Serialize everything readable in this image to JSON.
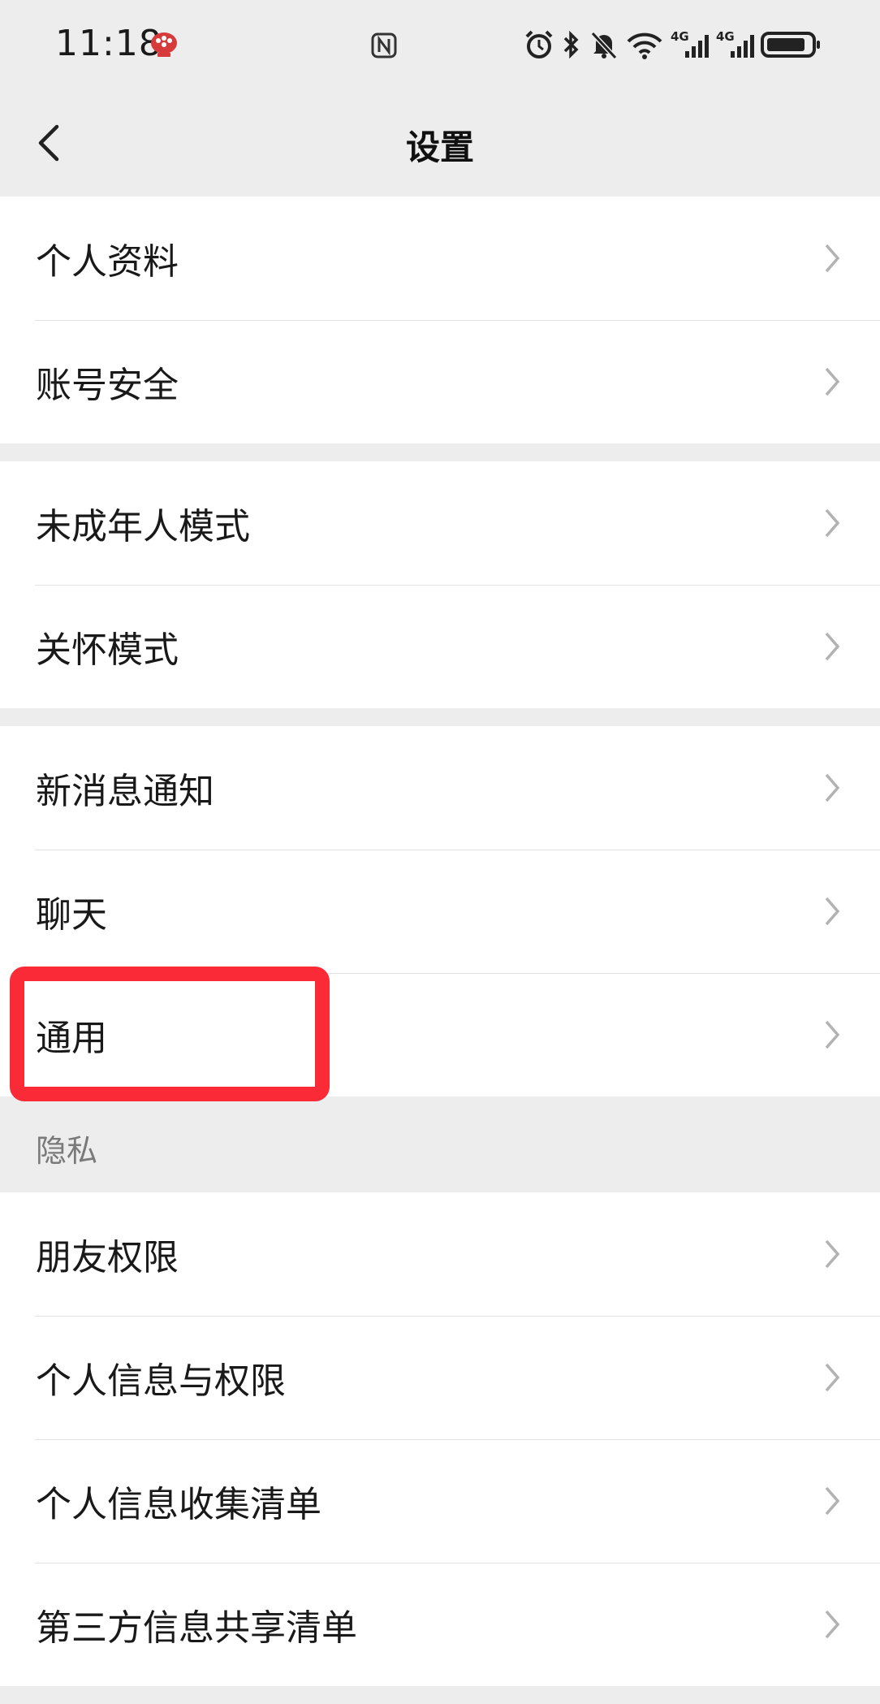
{
  "status_bar": {
    "time": "11:18",
    "icons": [
      "app-notification-icon",
      "nfc-icon",
      "alarm-icon",
      "bluetooth-icon",
      "mute-icon",
      "wifi-icon",
      "signal-4g-icon",
      "signal-4g-icon",
      "battery-icon"
    ],
    "signal_label_1": "4G",
    "signal_label_2": "4G"
  },
  "nav": {
    "title": "设置",
    "back_icon": "back-arrow-icon"
  },
  "groups": [
    {
      "items": [
        {
          "label": "个人资料"
        },
        {
          "label": "账号安全"
        }
      ]
    },
    {
      "items": [
        {
          "label": "未成年人模式"
        },
        {
          "label": "关怀模式"
        }
      ]
    },
    {
      "items": [
        {
          "label": "新消息通知"
        },
        {
          "label": "聊天"
        },
        {
          "label": "通用"
        }
      ]
    },
    {
      "header": "隐私",
      "items": [
        {
          "label": "朋友权限"
        },
        {
          "label": "个人信息与权限"
        },
        {
          "label": "个人信息收集清单"
        },
        {
          "label": "第三方信息共享清单"
        }
      ]
    }
  ],
  "highlight": {
    "target": "通用",
    "color": "#fa2a36"
  },
  "colors": {
    "background": "#ededed",
    "row_background": "#ffffff",
    "divider": "#e2e2e2",
    "chevron": "#b2b2b2",
    "section_header_text": "#7a7a7a"
  }
}
